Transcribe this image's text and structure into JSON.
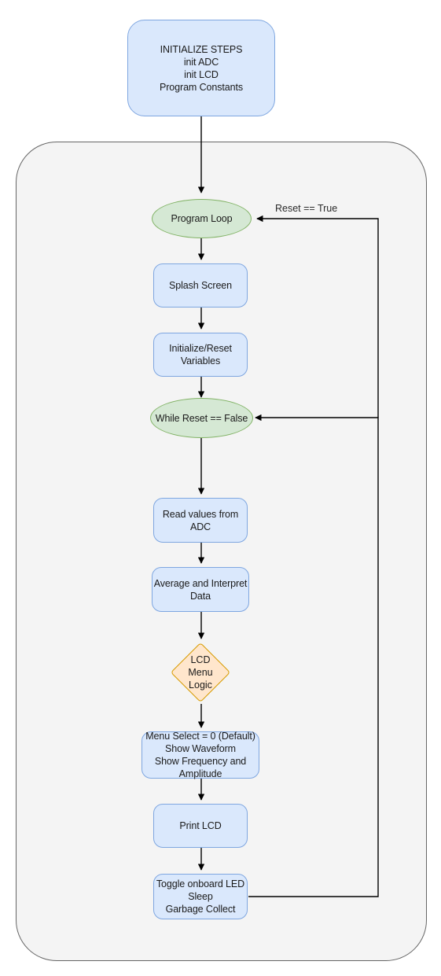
{
  "diagram": {
    "title_node": {
      "text": "INITIALIZE STEPS\ninit ADC\ninit LCD\nProgram Constants"
    },
    "container": {
      "label": ""
    },
    "nodes": {
      "program_loop": "Program Loop",
      "splash_screen": "Splash Screen",
      "init_reset_vars": "Initialize/Reset\nVariables",
      "while_reset_false": "While Reset == False",
      "read_adc": "Read values from\nADC",
      "average_interpret": "Average and Interpret\nData",
      "lcd_menu_logic": "LCD\nMenu\nLogic",
      "menu_select": "Menu Select = 0 (Default)\nShow Waveform\nShow Frequency and\nAmplitude",
      "print_lcd": "Print LCD",
      "toggle_led": "Toggle onboard LED\nSleep\nGarbage Collect"
    },
    "edge_labels": {
      "reset_true": "Reset == True"
    },
    "colors": {
      "process_fill": "#dae8fc",
      "process_stroke": "#7ea6e0",
      "terminal_fill": "#d5e8d4",
      "terminal_stroke": "#82b366",
      "decision_fill": "#ffe6cc",
      "decision_stroke": "#d79b00",
      "container_fill": "#f4f4f4",
      "container_stroke": "#666666",
      "edge_stroke": "#000000",
      "page_background": "#ffffff"
    }
  }
}
